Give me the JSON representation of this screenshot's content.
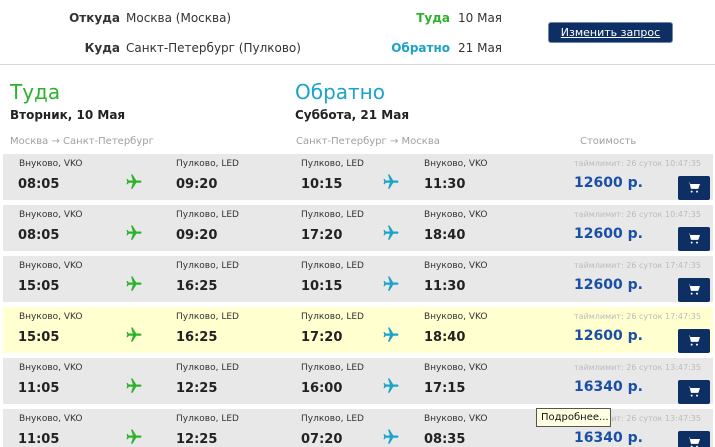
{
  "query": {
    "from_label": "Откуда",
    "from_value": "Москва (Москва)",
    "to_label": "Куда",
    "to_value": "Санкт-Петербург (Пулково)",
    "out_label": "Туда",
    "out_date": "10 Мая",
    "ret_label": "Обратно",
    "ret_date": "21 Мая",
    "change_button": "Изменить запрос"
  },
  "headers": {
    "out_title": "Туда",
    "out_date": "Вторник, 10 Мая",
    "ret_title": "Обратно",
    "ret_date": "Суббота, 21 Мая",
    "out_route": "Москва → Санкт-Петербург",
    "ret_route": "Санкт-Петербург → Москва",
    "price_col": "Стоимость"
  },
  "colors": {
    "out_accent": "#2db22d",
    "ret_accent": "#1ba3c8",
    "price": "#1a4fa8",
    "cart_bg": "#0d2f63",
    "row_bg": "#e8e8e8",
    "row_highlight": "#ffffd0"
  },
  "rows": [
    {
      "out_dep_ap": "Внуково, VKO",
      "out_dep_time": "08:05",
      "out_arr_ap": "Пулково, LED",
      "out_arr_time": "09:20",
      "ret_dep_ap": "Пулково, LED",
      "ret_dep_time": "10:15",
      "ret_arr_ap": "Внуково, VKO",
      "ret_arr_time": "11:30",
      "timelimit": "таймлимит: 26 суток 10:47:35",
      "price": "12600 р.",
      "highlight": false
    },
    {
      "out_dep_ap": "Внуково, VKO",
      "out_dep_time": "08:05",
      "out_arr_ap": "Пулково, LED",
      "out_arr_time": "09:20",
      "ret_dep_ap": "Пулково, LED",
      "ret_dep_time": "17:20",
      "ret_arr_ap": "Внуково, VKO",
      "ret_arr_time": "18:40",
      "timelimit": "таймлимит: 26 суток 10:47:35",
      "price": "12600 р.",
      "highlight": false
    },
    {
      "out_dep_ap": "Внуково, VKO",
      "out_dep_time": "15:05",
      "out_arr_ap": "Пулково, LED",
      "out_arr_time": "16:25",
      "ret_dep_ap": "Пулково, LED",
      "ret_dep_time": "10:15",
      "ret_arr_ap": "Внуково, VKO",
      "ret_arr_time": "11:30",
      "timelimit": "таймлимит: 26 суток 17:47:35",
      "price": "12600 р.",
      "highlight": false
    },
    {
      "out_dep_ap": "Внуково, VKO",
      "out_dep_time": "15:05",
      "out_arr_ap": "Пулково, LED",
      "out_arr_time": "16:25",
      "ret_dep_ap": "Пулково, LED",
      "ret_dep_time": "17:20",
      "ret_arr_ap": "Внуково, VKO",
      "ret_arr_time": "18:40",
      "timelimit": "таймлимит: 26 суток 17:47:35",
      "price": "12600 р.",
      "highlight": true
    },
    {
      "out_dep_ap": "Внуково, VKO",
      "out_dep_time": "11:05",
      "out_arr_ap": "Пулково, LED",
      "out_arr_time": "12:25",
      "ret_dep_ap": "Пулково, LED",
      "ret_dep_time": "16:00",
      "ret_arr_ap": "Внуково, VKO",
      "ret_arr_time": "17:15",
      "timelimit": "таймлимит: 26 суток 13:47:35",
      "price": "16340 р.",
      "highlight": false
    },
    {
      "out_dep_ap": "Внуково, VKO",
      "out_dep_time": "11:05",
      "out_arr_ap": "Пулково, LED",
      "out_arr_time": "12:25",
      "ret_dep_ap": "Пулково, LED",
      "ret_dep_time": "07:20",
      "ret_arr_ap": "Внуково, VKO",
      "ret_arr_time": "08:35",
      "timelimit": "таймлимит: 26 суток 13:47:35",
      "price": "16340 р.",
      "highlight": false
    }
  ],
  "tooltip": "Подробнее..."
}
